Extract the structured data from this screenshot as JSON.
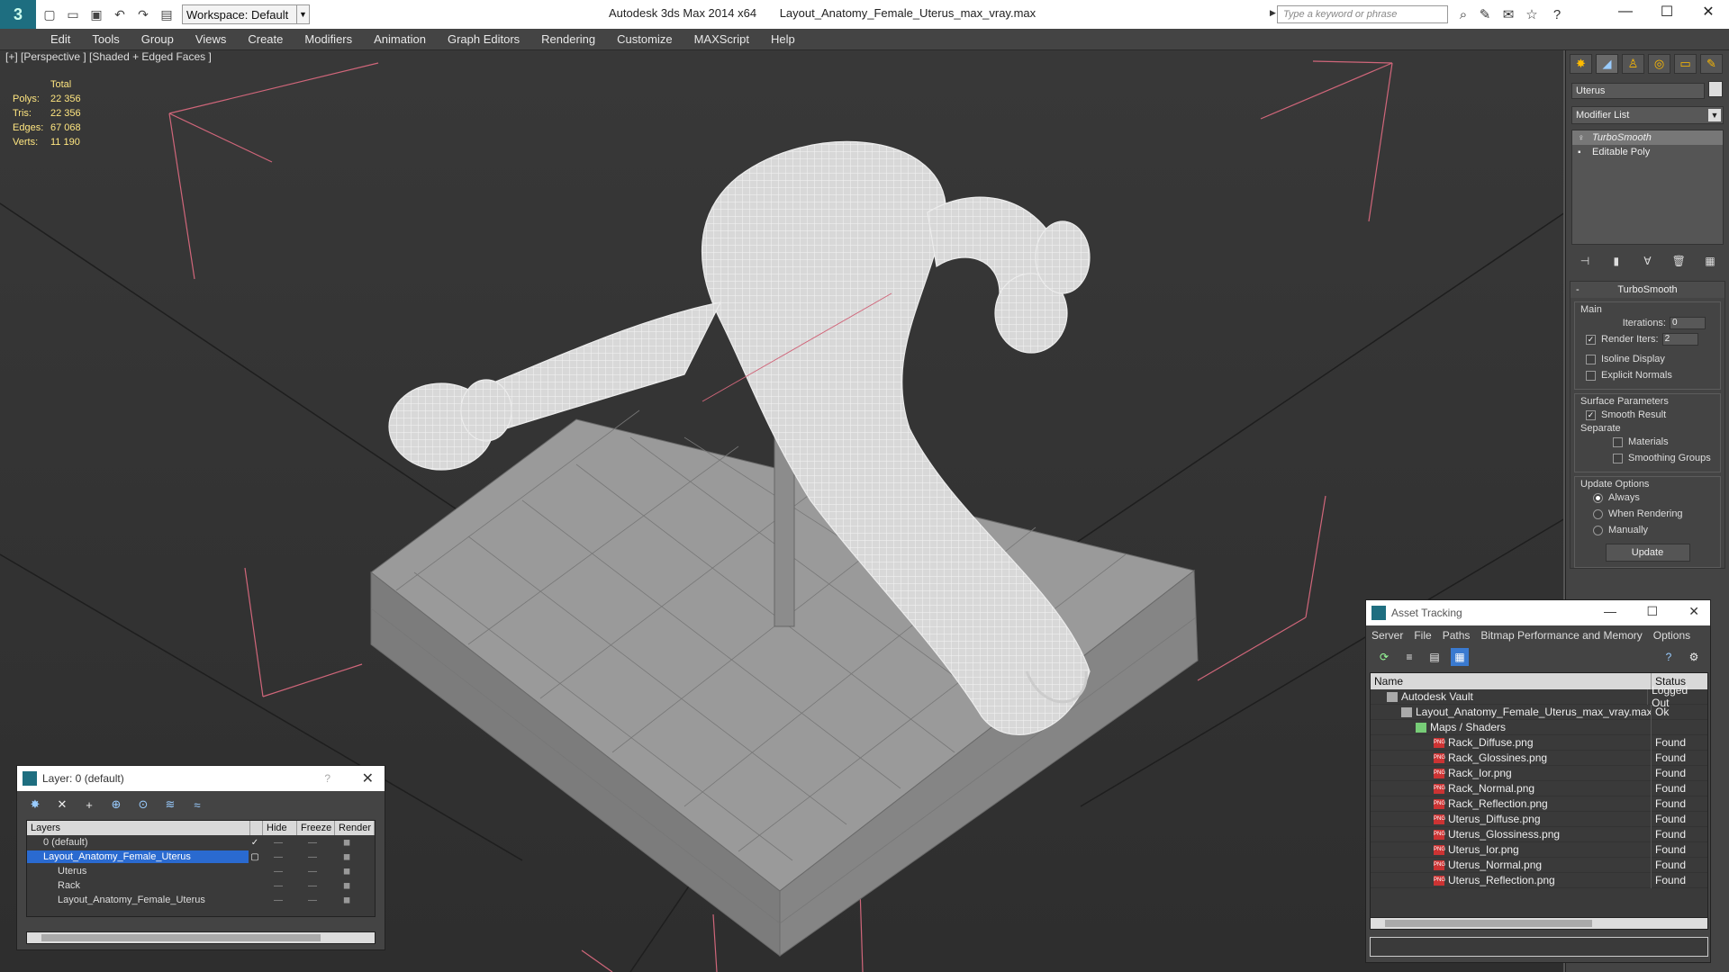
{
  "titlebar": {
    "workspace": "Workspace: Default",
    "app_name": "Autodesk 3ds Max  2014 x64",
    "file_name": "Layout_Anatomy_Female_Uterus_max_vray.max",
    "search_placeholder": "Type a keyword or phrase"
  },
  "menu": [
    "Edit",
    "Tools",
    "Group",
    "Views",
    "Create",
    "Modifiers",
    "Animation",
    "Graph Editors",
    "Rendering",
    "Customize",
    "MAXScript",
    "Help"
  ],
  "viewport": {
    "label": "[+] [Perspective ] [Shaded + Edged Faces ]",
    "stats_title": "Total",
    "stats": [
      {
        "k": "Polys:",
        "v": "22 356"
      },
      {
        "k": "Tris:",
        "v": "22 356"
      },
      {
        "k": "Edges:",
        "v": "67 068"
      },
      {
        "k": "Verts:",
        "v": "11 190"
      }
    ]
  },
  "command_panel": {
    "object_name": "Uterus",
    "modifier_list": "Modifier List",
    "stack": [
      "TurboSmooth",
      "Editable Poly"
    ],
    "rollout_title": "TurboSmooth",
    "main_label": "Main",
    "iterations_label": "Iterations:",
    "iterations_value": "0",
    "render_iters_label": "Render Iters:",
    "render_iters_value": "2",
    "isoline_label": "Isoline Display",
    "explicit_normals_label": "Explicit Normals",
    "surface_params_label": "Surface Parameters",
    "smooth_result_label": "Smooth Result",
    "separate_label": "Separate",
    "materials_label": "Materials",
    "smoothing_groups_label": "Smoothing Groups",
    "update_options_label": "Update Options",
    "always_label": "Always",
    "when_rendering_label": "When Rendering",
    "manually_label": "Manually",
    "update_button": "Update"
  },
  "layer_window": {
    "title": "Layer: 0 (default)",
    "help": "?",
    "columns": [
      "Layers",
      "Hide",
      "Freeze",
      "Render"
    ],
    "rows": [
      {
        "name": "0 (default)",
        "indent": 0
      },
      {
        "name": "Layout_Anatomy_Female_Uterus",
        "indent": 0,
        "selected": true
      },
      {
        "name": "Uterus",
        "indent": 1
      },
      {
        "name": "Rack",
        "indent": 1
      },
      {
        "name": "Layout_Anatomy_Female_Uterus",
        "indent": 1
      }
    ]
  },
  "asset_tracking": {
    "title": "Asset Tracking",
    "menu": [
      "Server",
      "File",
      "Paths",
      "Bitmap Performance and Memory",
      "Options"
    ],
    "columns": [
      "Name",
      "Status"
    ],
    "rows": [
      {
        "name": "Autodesk Vault",
        "status": "Logged Out",
        "indent": 0,
        "icon": "vault"
      },
      {
        "name": "Layout_Anatomy_Female_Uterus_max_vray.max",
        "status": "Ok",
        "indent": 1,
        "icon": "max"
      },
      {
        "name": "Maps / Shaders",
        "status": "",
        "indent": 2,
        "icon": "folder"
      },
      {
        "name": "Rack_Diffuse.png",
        "status": "Found",
        "indent": 3,
        "icon": "png"
      },
      {
        "name": "Rack_Glossines.png",
        "status": "Found",
        "indent": 3,
        "icon": "png"
      },
      {
        "name": "Rack_Ior.png",
        "status": "Found",
        "indent": 3,
        "icon": "png"
      },
      {
        "name": "Rack_Normal.png",
        "status": "Found",
        "indent": 3,
        "icon": "png"
      },
      {
        "name": "Rack_Reflection.png",
        "status": "Found",
        "indent": 3,
        "icon": "png"
      },
      {
        "name": "Uterus_Diffuse.png",
        "status": "Found",
        "indent": 3,
        "icon": "png"
      },
      {
        "name": "Uterus_Glossiness.png",
        "status": "Found",
        "indent": 3,
        "icon": "png"
      },
      {
        "name": "Uterus_Ior.png",
        "status": "Found",
        "indent": 3,
        "icon": "png"
      },
      {
        "name": "Uterus_Normal.png",
        "status": "Found",
        "indent": 3,
        "icon": "png"
      },
      {
        "name": "Uterus_Reflection.png",
        "status": "Found",
        "indent": 3,
        "icon": "png"
      }
    ]
  }
}
